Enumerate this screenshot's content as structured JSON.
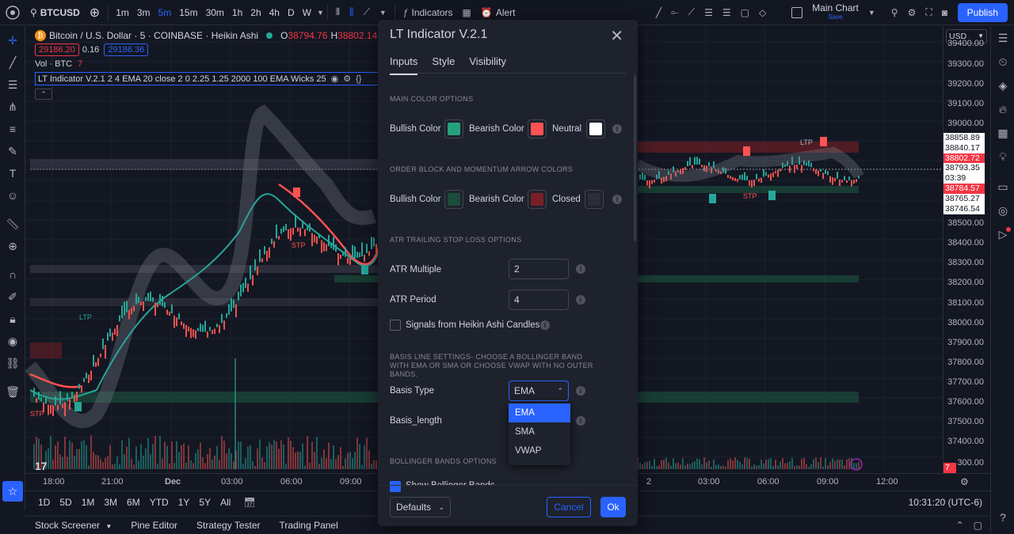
{
  "topbar": {
    "symbol": "BTCUSD",
    "timeframes": [
      "1m",
      "3m",
      "5m",
      "15m",
      "30m",
      "1h",
      "2h",
      "4h",
      "D",
      "W"
    ],
    "active_timeframe": "5m",
    "indicators_label": "Indicators",
    "alert_label": "Alert",
    "layout_name": "Main Chart",
    "layout_sub": "Save",
    "publish_label": "Publish"
  },
  "legend": {
    "title": "Bitcoin / U.S. Dollar · 5 · COINBASE · Heikin Ashi",
    "open_label": "O",
    "open_value": "38794.76",
    "high_label": "H",
    "high_value": "38802.14",
    "bid": "29186.20",
    "spread": "0.16",
    "ask": "29186.36",
    "vol_label": "Vol · BTC",
    "vol_value": "7",
    "indicator_line": "LT Indicator V.2.1  2 4 EMA 20 close 2 0 2.25 1.25 2000 100 EMA Wicks 25"
  },
  "price_axis": {
    "currency": "USD",
    "ticks": [
      "39400.00",
      "39300.00",
      "39200.00",
      "39100.00",
      "39000.00",
      "38500.00",
      "38400.00",
      "38300.00",
      "38200.00",
      "38100.00",
      "38000.00",
      "37900.00",
      "37800.00",
      "37700.00",
      "37600.00",
      "37500.00",
      "37400.00",
      "300.00"
    ],
    "tags": [
      {
        "text": "38858.89",
        "color": "#ffffff"
      },
      {
        "text": "38840.17",
        "color": "#ffffff"
      },
      {
        "text": "38802.72",
        "color": "#f23645"
      },
      {
        "text": "38793.35",
        "color": "#ffffff"
      },
      {
        "text": "03:39",
        "color": "#ffffff"
      },
      {
        "text": "38784.57",
        "color": "#f23645"
      },
      {
        "text": "38765.27",
        "color": "#ffffff"
      },
      {
        "text": "38746.54",
        "color": "#ffffff"
      }
    ],
    "vol_tag": "7"
  },
  "time_axis": {
    "labels": [
      "18:00",
      "21:00",
      "Dec",
      "03:00",
      "06:00",
      "09:00",
      "2",
      "03:00",
      "06:00",
      "09:00",
      "12:00"
    ]
  },
  "ranges": [
    "1D",
    "5D",
    "1M",
    "3M",
    "6M",
    "YTD",
    "1Y",
    "5Y",
    "All"
  ],
  "clock": "10:31:20 (UTC-6)",
  "bottom_tabs": [
    "Stock Screener",
    "Pine Editor",
    "Strategy Tester",
    "Trading Panel"
  ],
  "chart_annotations": {
    "ltp": "LTP",
    "stp": "STP"
  },
  "dialog": {
    "title": "LT Indicator V.2.1",
    "tabs": [
      "Inputs",
      "Style",
      "Visibility"
    ],
    "active_tab": "Inputs",
    "sections": {
      "main_color": "MAIN COLOR OPTIONS",
      "ob_colors": "ORDER BLOCK AND MOMENTUM ARROW COLORS",
      "atr": "ATR TRAILING STOP LOSS OPTIONS",
      "basis": "BASIS LINE SETTINGS- CHOOSE A BOLLINGER BAND WITH EMA OR SMA OR CHOOSE VWAP WITH NO OUTER BANDS.",
      "bollinger": "BOLLINGER BANDS OPTIONS"
    },
    "main_colors": {
      "bullish_label": "Bullish Color",
      "bullish": "#26a17b",
      "bearish_label": "Bearish Color",
      "bearish": "#ff5252",
      "neutral_label": "Neutral",
      "neutral": "#ffffff"
    },
    "ob_colors": {
      "bullish_label": "Bullish Color",
      "bullish": "#1b4d3a",
      "bearish_label": "Bearish Color",
      "bearish": "#7a1f26",
      "closed_label": "Closed",
      "closed": "#2a2e39"
    },
    "atr_multiple_label": "ATR Multiple",
    "atr_multiple": "2",
    "atr_period_label": "ATR Period",
    "atr_period": "4",
    "heikin_signals_label": "Signals from Heikin Ashi Candles",
    "basis_type_label": "Basis Type",
    "basis_type": "EMA",
    "basis_length_label": "Basis_length",
    "basis_options": [
      "EMA",
      "SMA",
      "VWAP"
    ],
    "show_bb_label": "Show Bollinger Bands",
    "defaults_label": "Defaults",
    "cancel_label": "Cancel",
    "ok_label": "Ok"
  }
}
